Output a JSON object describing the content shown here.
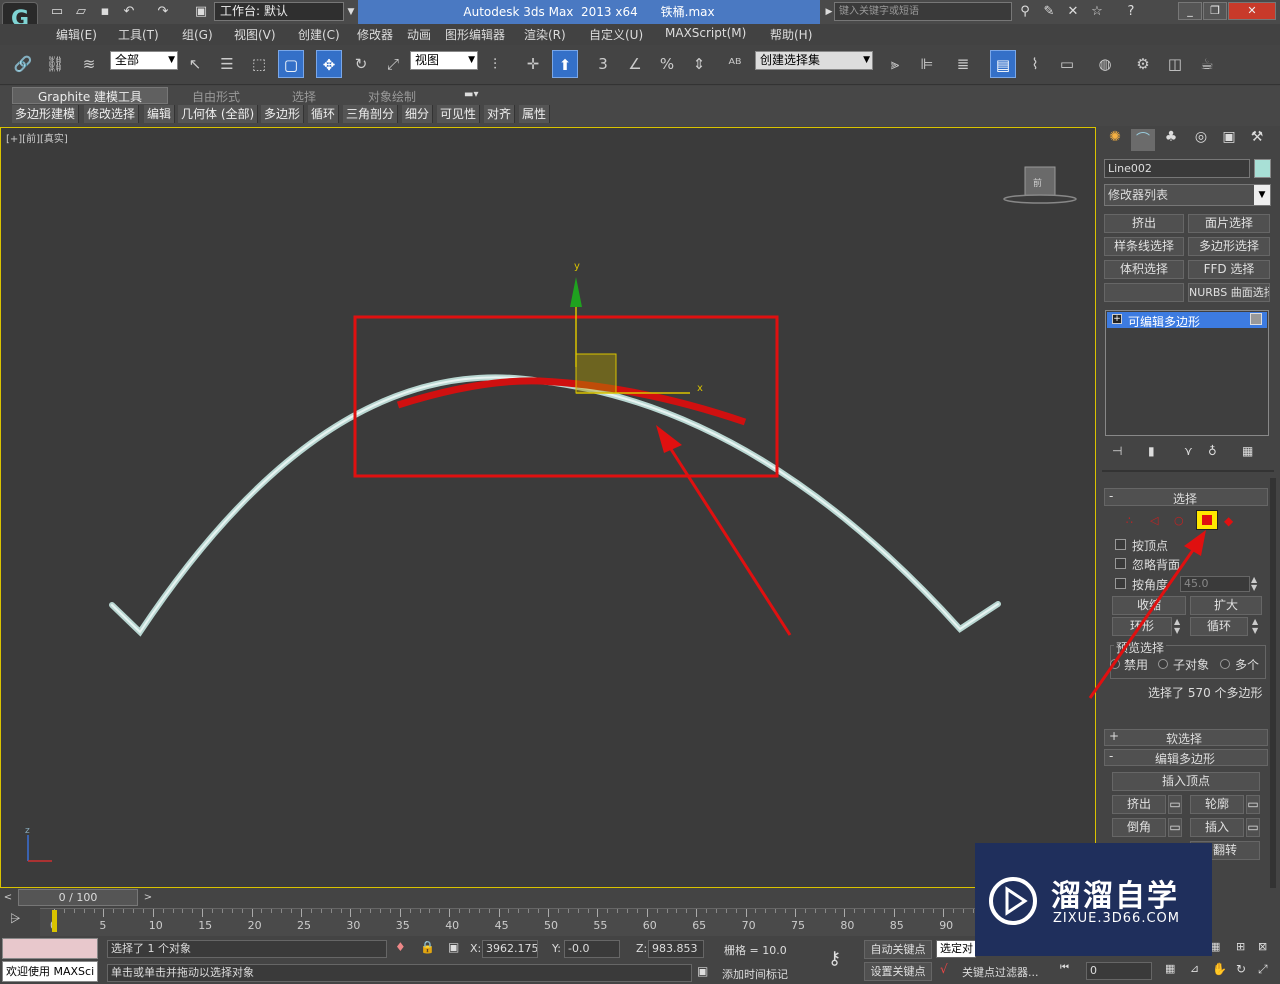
{
  "titlebar": {
    "app_title": "Autodesk 3ds Max  2013 x64      铁桶.max",
    "workspace_label": "工作台: 默认",
    "search_placeholder": "键入关键字或短语"
  },
  "menu": [
    "编辑(E)",
    "工具(T)",
    "组(G)",
    "视图(V)",
    "创建(C)",
    "修改器",
    "动画",
    "图形编辑器",
    "渲染(R)",
    "自定义(U)",
    "MAXScript(M)",
    "帮助(H)"
  ],
  "toolbar": {
    "filter_value": "全部",
    "refcoord_value": "视图",
    "snap_3": "3",
    "selset_value": "创建选择集"
  },
  "ribbon": {
    "tabs": [
      "Graphite 建模工具",
      "自由形式",
      "选择",
      "对象绘制"
    ],
    "subtabs": [
      "多边形建模",
      "修改选择",
      "编辑",
      "几何体 (全部)",
      "多边形",
      "循环",
      "三角剖分",
      "细分",
      "可见性",
      "对齐",
      "属性"
    ]
  },
  "viewport": {
    "label": "[+][前][真实]",
    "gizmo_y": "y",
    "gizmo_x": "x",
    "nav_cube": "前",
    "axis_z": "z"
  },
  "command_panel": {
    "object_name": "Line002",
    "modifier_list": "修改器列表",
    "modifier_buttons": [
      "挤出",
      "面片选择",
      "样条线选择",
      "多边形选择",
      "体积选择",
      "FFD 选择",
      "",
      "NURBS 曲面选择"
    ],
    "stack_item": "可编辑多边形",
    "selection_rollout": "选择",
    "by_vertex": "按顶点",
    "ignore_backfacing": "忽略背面",
    "by_angle": "按角度",
    "angle_value": "45.0",
    "shrink": "收缩",
    "grow": "扩大",
    "ring": "环形",
    "loop": "循环",
    "preview_selection": "预览选择",
    "disabled": "禁用",
    "subobject": "子对象",
    "multi": "多个",
    "selection_info": "选择了 570 个多边形",
    "soft_selection": "软选择",
    "edit_polygons": "编辑多边形",
    "insert_vertex": "插入顶点",
    "extrude": "挤出",
    "outline": "轮廓",
    "bevel": "倒角",
    "inset": "插入",
    "flip": "翻转",
    "rollout_minus": "-",
    "rollout_plus": "+"
  },
  "timeline": {
    "frame_counter": "0 / 100",
    "ticks": [
      "0",
      "5",
      "10",
      "15",
      "20",
      "25",
      "30",
      "35",
      "40",
      "45",
      "50",
      "55",
      "60",
      "65",
      "70",
      "75",
      "80",
      "85",
      "90"
    ]
  },
  "status": {
    "welcome": "欢迎使用 MAXSci",
    "selected": "选择了 1 个对象",
    "prompt": "单击或单击并拖动以选择对象",
    "x_label": "X:",
    "x_value": "3962.175",
    "y_label": "Y:",
    "y_value": "-0.0",
    "z_label": "Z:",
    "z_value": "983.853",
    "grid": "栅格 = 10.0",
    "add_time_tag": "添加时间标记",
    "auto_key": "自动关键点",
    "set_key": "设置关键点",
    "selected_dd": "选定对",
    "key_filters": "关键点过滤器...",
    "frame_value": "0"
  },
  "watermark": {
    "brand": "溜溜自学",
    "url": "ZIXUE.3D66.COM"
  },
  "colors": {
    "title_blue": "#4a79c2",
    "highlight_red": "#e01010",
    "pipe_color": "#c8e0dc",
    "viewport_border": "#d9c300",
    "watermark_bg": "#1f2f5c"
  }
}
